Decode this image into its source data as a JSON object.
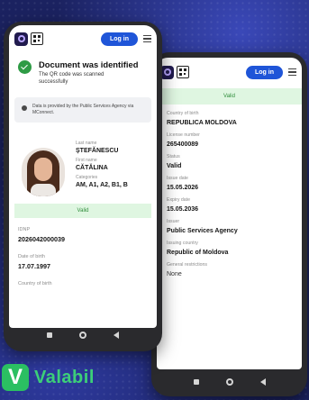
{
  "header": {
    "login_label": "Log in"
  },
  "front": {
    "status_title": "Document was identified",
    "status_subtitle": "The QR code was scanned successfully",
    "info_text": "Data is provided by the Public Services Agency via MConnect.",
    "profile": {
      "last_name_label": "Last name",
      "last_name": "ȘTEFĂNESCU",
      "first_name_label": "First name",
      "first_name": "CĂTĂLINA",
      "categories_label": "Categories",
      "categories": "AM, A1, A2, B1, B"
    },
    "valid_label": "Valid",
    "idnp_label": "IDNP",
    "idnp": "2026042000039",
    "dob_label": "Date of birth",
    "dob": "17.07.1997",
    "country_label": "Country of birth"
  },
  "back": {
    "valid_label": "Valid",
    "fields": [
      {
        "label": "Country of birth",
        "value": "REPUBLICA MOLDOVA"
      },
      {
        "label": "License number",
        "value": "265400089"
      },
      {
        "label": "Status",
        "value": "Valid"
      },
      {
        "label": "Issue date",
        "value": "15.05.2026"
      },
      {
        "label": "Expiry date",
        "value": "15.05.2036"
      },
      {
        "label": "Issuer",
        "value": "Public Services Agency"
      },
      {
        "label": "Issuing country",
        "value": "Republic of Moldova"
      },
      {
        "label": "General restrictions",
        "value": "None"
      }
    ]
  },
  "brand": {
    "mark": "V",
    "name": "Valabil",
    "color": "#2bbf62"
  }
}
